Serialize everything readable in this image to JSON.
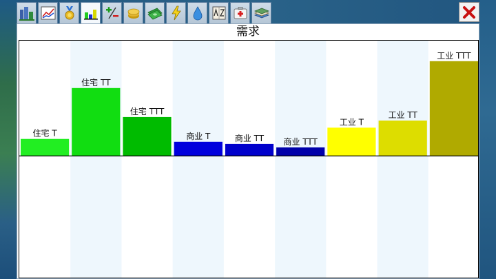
{
  "window": {
    "title": "需求"
  },
  "toolbar": {
    "tabs": [
      {
        "icon": "city-icon",
        "active": false
      },
      {
        "icon": "line-graph-icon",
        "active": false
      },
      {
        "icon": "medal-icon",
        "active": false
      },
      {
        "icon": "bar-chart-icon",
        "active": true
      },
      {
        "icon": "plus-minus-icon",
        "active": false
      },
      {
        "icon": "coins-icon",
        "active": false
      },
      {
        "icon": "money-icon",
        "active": false
      },
      {
        "icon": "power-icon",
        "active": false
      },
      {
        "icon": "water-drop-icon",
        "active": false
      },
      {
        "icon": "dictionary-icon",
        "active": false
      },
      {
        "icon": "first-aid-icon",
        "active": false
      },
      {
        "icon": "books-icon",
        "active": false
      }
    ],
    "close_icon": "close-icon"
  },
  "colors": {
    "stripe": "#eef7fd",
    "axis": "#000000"
  },
  "chart_data": {
    "type": "bar",
    "title": "需求",
    "xlabel": "",
    "ylabel": "",
    "categories": [
      "住宅 T",
      "住宅 TT",
      "住宅 TTT",
      "商业 T",
      "商业 TT",
      "商业 TTT",
      "工业 T",
      "工业 TT",
      "工业 TTT"
    ],
    "values": [
      24,
      96,
      55,
      20,
      17,
      12,
      40,
      50,
      134
    ],
    "colors": [
      "#22ee22",
      "#11dd11",
      "#00bb00",
      "#0000dd",
      "#0000cc",
      "#0000aa",
      "#ffff00",
      "#dddd00",
      "#b0aa00"
    ],
    "ylim": [
      -174,
      163
    ],
    "grid": false,
    "legend": "none"
  }
}
